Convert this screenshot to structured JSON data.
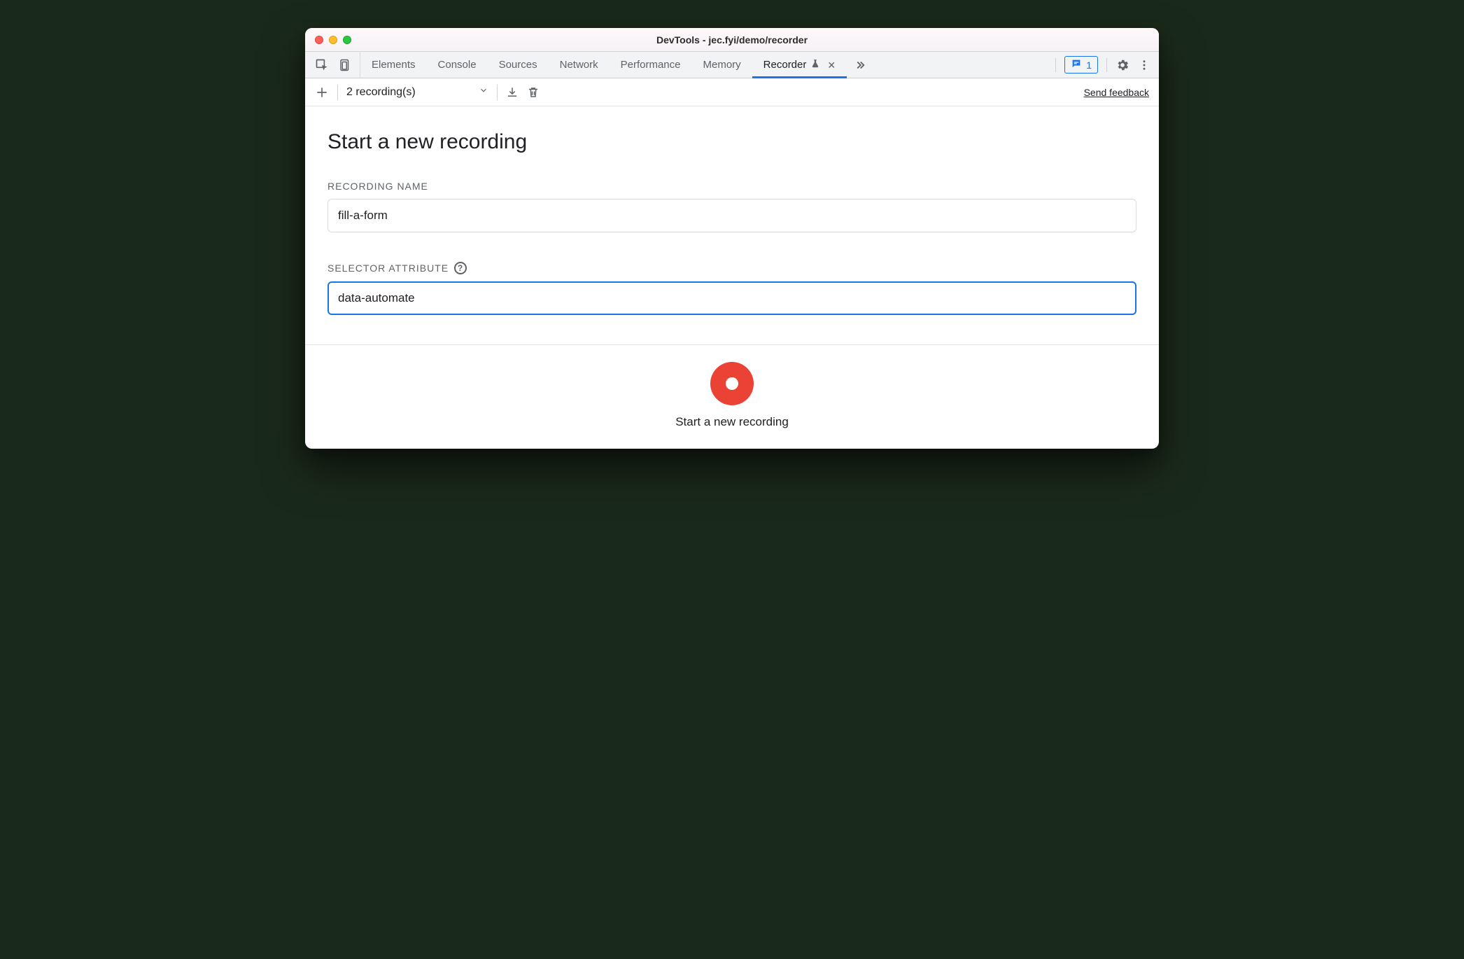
{
  "window": {
    "title": "DevTools - jec.fyi/demo/recorder"
  },
  "tabs": {
    "items": [
      {
        "label": "Elements",
        "active": false
      },
      {
        "label": "Console",
        "active": false
      },
      {
        "label": "Sources",
        "active": false
      },
      {
        "label": "Network",
        "active": false
      },
      {
        "label": "Performance",
        "active": false
      },
      {
        "label": "Memory",
        "active": false
      },
      {
        "label": "Recorder",
        "active": true,
        "experimental": true,
        "closable": true
      }
    ],
    "issues_count": "1"
  },
  "toolbar": {
    "recordings_label": "2 recording(s)",
    "feedback_label": "Send feedback"
  },
  "main": {
    "title": "Start a new recording",
    "recording_name_label": "Recording Name",
    "recording_name_value": "fill-a-form",
    "selector_attr_label": "Selector Attribute",
    "selector_attr_value": "data-automate"
  },
  "footer": {
    "start_label": "Start a new recording"
  }
}
